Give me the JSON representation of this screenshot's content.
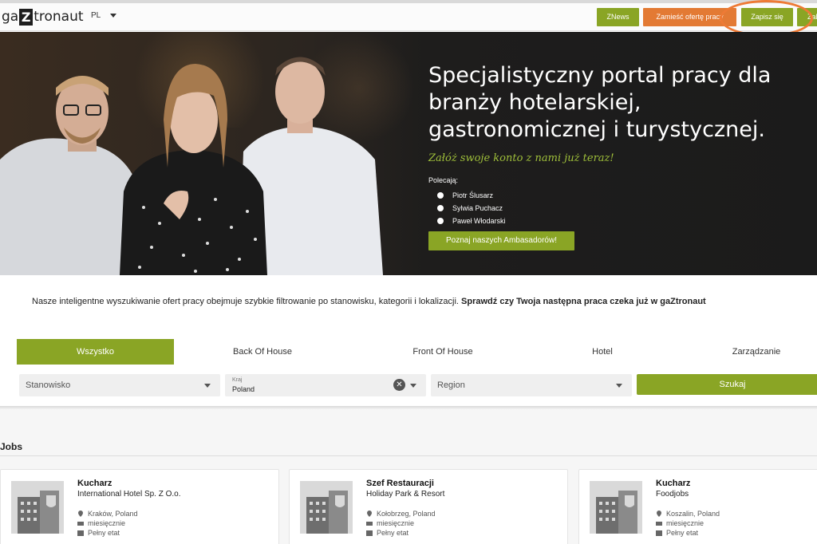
{
  "header": {
    "logo_pre": "ga",
    "logo_z": "Z",
    "logo_post": "tronaut",
    "lang": "PL",
    "btn_znews": "ZNews",
    "btn_offer": "Zamieść ofertę pracy",
    "btn_signup": "Zapisz się",
    "btn_login": "Zal"
  },
  "hero": {
    "title": "Specjalistyczny portal pracy dla branży hotelarskiej, gastronomicznej i turystycznej.",
    "tagline": "Załóż swoje konto z nami już teraz!",
    "recommend_label": "Polecają:",
    "ambassadors": [
      "Piotr Ślusarz",
      "Sylwia Puchacz",
      "Paweł Włodarski"
    ],
    "cta": "Poznaj naszych Ambasadorów!"
  },
  "intro": {
    "text": "Nasze inteligentne wyszukiwanie ofert pracy obejmuje szybkie filtrowanie po stanowisku, kategorii i lokalizacji.",
    "bold": "Sprawdź czy Twoja następna praca czeka już w gaZtronaut"
  },
  "search": {
    "tabs": [
      "Wszystko",
      "Back Of House",
      "Front Of House",
      "Hotel",
      "Zarządzanie"
    ],
    "position_placeholder": "Stanowisko",
    "country_label": "Kraj",
    "country_value": "Poland",
    "region_placeholder": "Region",
    "submit": "Szukaj"
  },
  "jobs": {
    "heading": "Jobs",
    "items": [
      {
        "title": "Kucharz",
        "company": "International Hotel Sp. Z O.o.",
        "location": "Kraków, Poland",
        "salary": "miesięcznie",
        "type": "Pełny etat"
      },
      {
        "title": "Szef Restauracji",
        "company": "Holiday Park & Resort",
        "location": "Kołobrzeg, Poland",
        "salary": "miesięcznie",
        "type": "Pełny etat"
      },
      {
        "title": "Kucharz",
        "company": "Foodjobs",
        "location": "Koszalin, Poland",
        "salary": "miesięcznie",
        "type": "Pełny etat"
      }
    ]
  },
  "colors": {
    "accent": "#8aa525",
    "orange": "#e37a34",
    "hero_bg": "#1b1b1b"
  }
}
